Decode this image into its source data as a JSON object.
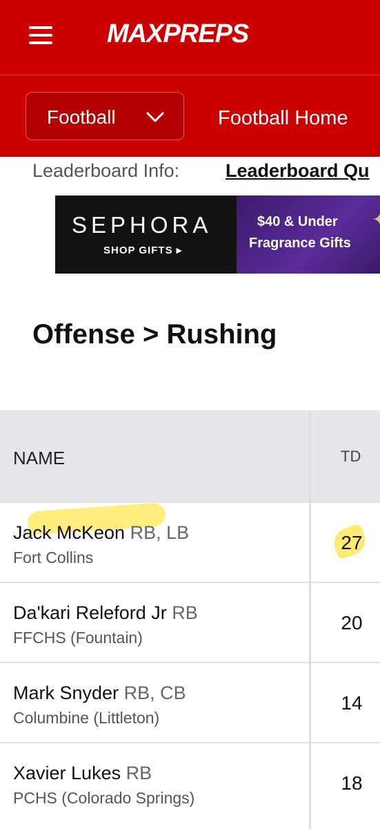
{
  "header": {
    "logo_text": "MAXPREPS",
    "sport_dropdown": {
      "label": "Football"
    },
    "home_link": "Football Home"
  },
  "leaderboard_info": {
    "label": "Leaderboard Info:",
    "link_text": "Leaderboard Qu"
  },
  "ad": {
    "brand": "SEPHORA",
    "tagline": "SHOP GIFTS ▸",
    "line1": "$40 & Under",
    "line2": "Fragrance Gifts"
  },
  "section_title": "Offense > Rushing",
  "table": {
    "columns": [
      "NAME",
      "TD"
    ],
    "rows": [
      {
        "name": "Jack McKeon",
        "position": "RB, LB",
        "school": "Fort Collins",
        "td": "27"
      },
      {
        "name": "Da'kari Releford Jr",
        "position": "RB",
        "school": "FFCHS (Fountain)",
        "td": "20"
      },
      {
        "name": "Mark Snyder",
        "position": "RB, CB",
        "school": "Columbine (Littleton)",
        "td": "14"
      },
      {
        "name": "Xavier Lukes",
        "position": "RB",
        "school": "PCHS (Colorado Springs)",
        "td": "18"
      }
    ]
  },
  "colors": {
    "brand_red": "#cc0000",
    "highlight": "#ffe128"
  }
}
